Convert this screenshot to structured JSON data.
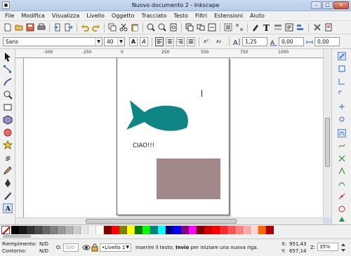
{
  "window": {
    "title": "Nuovo documento 2 - Inkscape"
  },
  "menu": [
    "File",
    "Modifica",
    "Visualizza",
    "Livello",
    "Oggetto",
    "Tracciato",
    "Testo",
    "Filtri",
    "Estensioni",
    "Aiuto"
  ],
  "textbar": {
    "font_family": "Sans",
    "font_size": "40",
    "bold_glyph": "A",
    "italic_glyph": "A",
    "superscript_glyph": "x²",
    "subscript_glyph": "x₂",
    "line_spacing": "1,25",
    "letter_spacing": "0,00",
    "word_spacing": "0,00"
  },
  "ruler": {
    "labels": [
      "-500",
      "-250",
      "0",
      "250",
      "500",
      "750",
      "1000"
    ]
  },
  "canvas": {
    "text": "CIAO!!!",
    "fish_color": "#0f8585",
    "rect_color": "#a08888"
  },
  "palette": {
    "colors": [
      "#000000",
      "#1a1a1a",
      "#333333",
      "#4d4d4d",
      "#666666",
      "#808080",
      "#999999",
      "#b3b3b3",
      "#cccccc",
      "#e6e6e6",
      "#f2f2f2",
      "#ffffff",
      "#800000",
      "#ff0000",
      "#808000",
      "#ffff00",
      "#008000",
      "#00ff00",
      "#008080",
      "#00ffff",
      "#000080",
      "#0000ff",
      "#800080",
      "#ff00ff",
      "#800000",
      "#d40000",
      "#ff0000",
      "#ff2a2a",
      "#ff5555",
      "#ff8080",
      "#ffaaaa",
      "#ffd5d5",
      "#ff6600",
      "#aa0000"
    ]
  },
  "status": {
    "fill_label": "Riempimento:",
    "fill_value": "N/D",
    "stroke_label": "Contorno:",
    "stroke_value": "N/D",
    "opacity_label": "O:",
    "opacity_value": "100",
    "layer": "•Livello 1",
    "message_pre": "Inserire il testo; ",
    "message_bold": "Invio",
    "message_post": " per iniziare una nuova riga.",
    "x_label": "X:",
    "x_value": "951,43",
    "y_label": "Y:",
    "y_value": "657,14",
    "zoom_label": "Z:",
    "zoom_value": "35%"
  }
}
